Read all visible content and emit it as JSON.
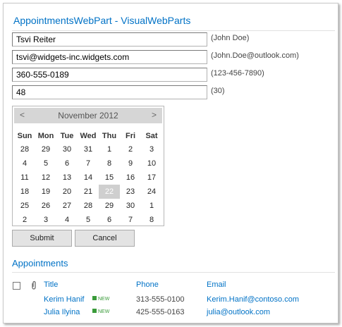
{
  "webpart": {
    "title": "AppointmentsWebPart - VisualWebParts"
  },
  "form": {
    "fields": [
      {
        "value": "Tsvi Reiter",
        "hint": "(John Doe)"
      },
      {
        "value": "tsvi@widgets-inc.widgets.com",
        "hint": "(John.Doe@outlook.com)"
      },
      {
        "value": "360-555-0189",
        "hint": "(123-456-7890)"
      },
      {
        "value": "48",
        "hint": "(30)"
      }
    ]
  },
  "calendar": {
    "prev": "<",
    "next": ">",
    "month_label": "November 2012",
    "weekdays": [
      "Sun",
      "Mon",
      "Tue",
      "Wed",
      "Thu",
      "Fri",
      "Sat"
    ],
    "weeks": [
      [
        "28",
        "29",
        "30",
        "31",
        "1",
        "2",
        "3"
      ],
      [
        "4",
        "5",
        "6",
        "7",
        "8",
        "9",
        "10"
      ],
      [
        "11",
        "12",
        "13",
        "14",
        "15",
        "16",
        "17"
      ],
      [
        "18",
        "19",
        "20",
        "21",
        "22",
        "23",
        "24"
      ],
      [
        "25",
        "26",
        "27",
        "28",
        "29",
        "30",
        "1"
      ],
      [
        "2",
        "3",
        "4",
        "5",
        "6",
        "7",
        "8"
      ]
    ],
    "selected_day": "22"
  },
  "buttons": {
    "submit": "Submit",
    "cancel": "Cancel"
  },
  "appointments": {
    "title": "Appointments",
    "columns": {
      "title": "Title",
      "phone": "Phone",
      "email": "Email"
    },
    "rows": [
      {
        "title": "Kerim Hanif",
        "badge": "NEW",
        "phone": "313-555-0100",
        "email": "Kerim.Hanif@contoso.com"
      },
      {
        "title": "Julia Ilyina",
        "badge": "NEW",
        "phone": "425-555-0163",
        "email": "julia@outlook.com"
      }
    ]
  },
  "colors": {
    "link": "#0072c6",
    "new_badge": "#3a9b3a",
    "calendar_header": "#d6d6d6",
    "selected_day": "#cfcfcf"
  }
}
